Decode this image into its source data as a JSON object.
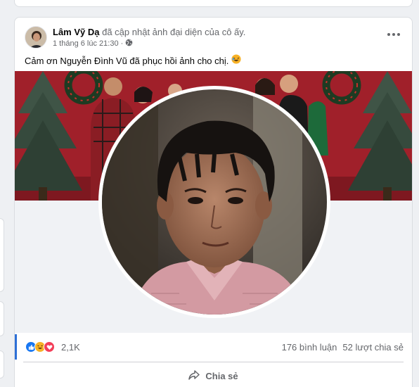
{
  "post": {
    "author": "Lâm Vỹ Dạ",
    "action": "đã cập nhật ảnh đại diện của cô ấy.",
    "timestamp": "1 tháng 6 lúc 21:30",
    "privacy_icon": "globe-icon",
    "more_icon": "more-horizontal-icon",
    "caption": "Cảm ơn Nguyễn Đình Vũ đã phục hồi ảnh cho chị.",
    "caption_emoji": "rolling-laughing-emoji"
  },
  "stats": {
    "reaction_icons": [
      "like-reaction-icon",
      "haha-reaction-icon",
      "love-reaction-icon"
    ],
    "reaction_count": "2,1K",
    "comments": "176 bình luận",
    "shares": "52 lượt chia sẻ"
  },
  "actions": {
    "share_label": "Chia sẻ",
    "share_icon": "share-arrow-icon"
  },
  "colors": {
    "like_blue": "#1877f2",
    "haha_yellow": "#f7b125",
    "love_red": "#f33e58",
    "cover_red": "#a0202a",
    "accent_bar": "#2d6fd6"
  }
}
